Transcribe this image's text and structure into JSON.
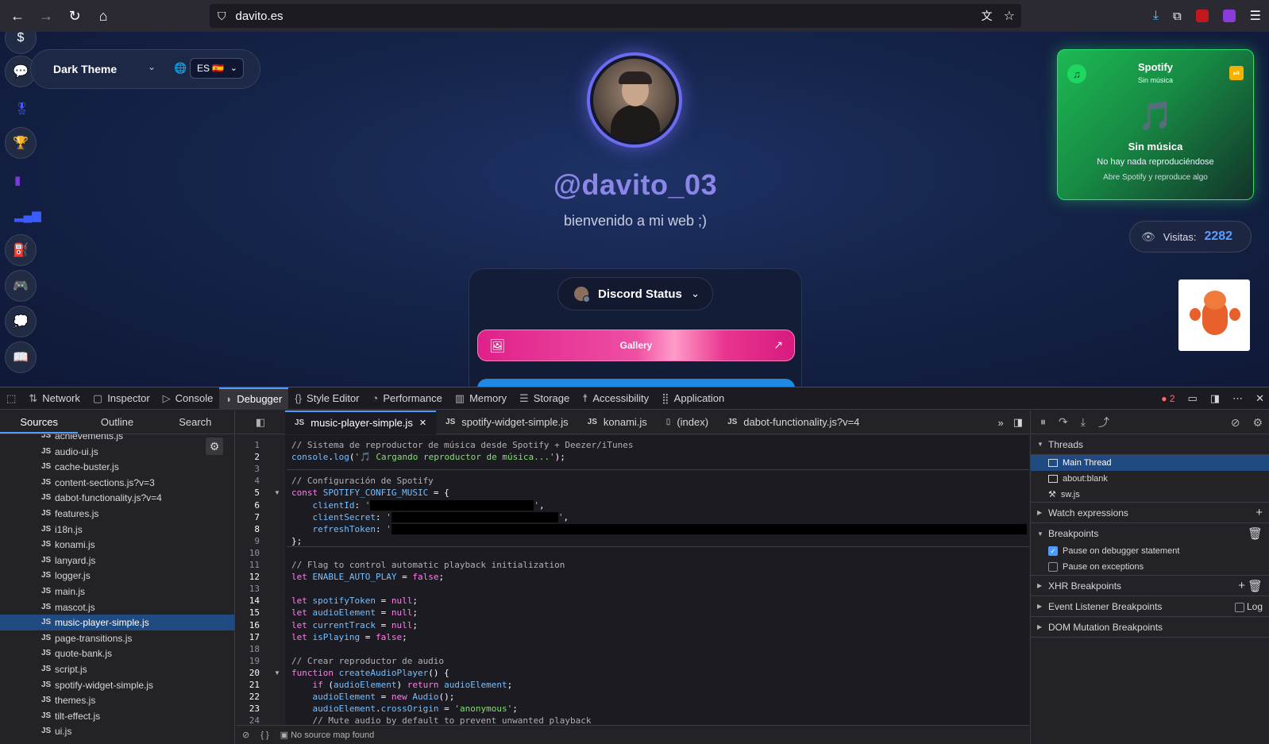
{
  "browser": {
    "url": "davito.es",
    "back_icon": "arrow-left-icon",
    "forward_icon": "arrow-right-icon",
    "reload_icon": "reload-icon",
    "home_icon": "home-icon"
  },
  "page": {
    "theme_label": "Dark Theme",
    "lang_label": "ES 🇪🇸",
    "username": "@davito_03",
    "tagline": "bienvenido a mi web ;)",
    "discord_label": "Discord Status",
    "gallery_label": "Gallery",
    "spotify": {
      "title": "Spotify",
      "subtitle": "Sin música",
      "heading": "Sin música",
      "line1": "No hay nada reproduciéndose",
      "line2": "Abre Spotify y reproduce algo"
    },
    "visits_label": "Visitas:",
    "visits_count": "2282"
  },
  "devtools": {
    "tabs": [
      {
        "label": "Network",
        "icon": "⇅"
      },
      {
        "label": "Inspector",
        "icon": "▢"
      },
      {
        "label": "Console",
        "icon": "▷"
      },
      {
        "label": "Debugger",
        "icon": "◗"
      },
      {
        "label": "Style Editor",
        "icon": "{}"
      },
      {
        "label": "Performance",
        "icon": "◔"
      },
      {
        "label": "Memory",
        "icon": "▥"
      },
      {
        "label": "Storage",
        "icon": "☰"
      },
      {
        "label": "Accessibility",
        "icon": "☨"
      },
      {
        "label": "Application",
        "icon": "⣿"
      }
    ],
    "active_tab": "Debugger",
    "error_count": "2",
    "left_tabs": [
      "Sources",
      "Outline",
      "Search"
    ],
    "files": [
      "achievements.js",
      "audio-ui.js",
      "cache-buster.js",
      "content-sections.js?v=3",
      "dabot-functionality.js?v=4",
      "features.js",
      "i18n.js",
      "konami.js",
      "lanyard.js",
      "logger.js",
      "main.js",
      "mascot.js",
      "music-player-simple.js",
      "page-transitions.js",
      "quote-bank.js",
      "script.js",
      "spotify-widget-simple.js",
      "themes.js",
      "tilt-effect.js",
      "ui.js"
    ],
    "selected_file": "music-player-simple.js",
    "editor_tabs": [
      {
        "label": "music-player-simple.js",
        "kind": "JS"
      },
      {
        "label": "spotify-widget-simple.js",
        "kind": "JS"
      },
      {
        "label": "konami.js",
        "kind": "JS"
      },
      {
        "label": "(index)",
        "kind": "doc"
      },
      {
        "label": "dabot-functionality.js?v=4",
        "kind": "JS"
      }
    ],
    "footer_text": "No source map found",
    "right": {
      "threads_label": "Threads",
      "threads": [
        "Main Thread",
        "about:blank",
        "sw.js"
      ],
      "watch_label": "Watch expressions",
      "breakpoints_label": "Breakpoints",
      "pause_debugger": "Pause on debugger statement",
      "pause_exceptions": "Pause on exceptions",
      "xhr_label": "XHR Breakpoints",
      "event_label": "Event Listener Breakpoints",
      "log_label": "Log",
      "dom_label": "DOM Mutation Breakpoints"
    }
  }
}
